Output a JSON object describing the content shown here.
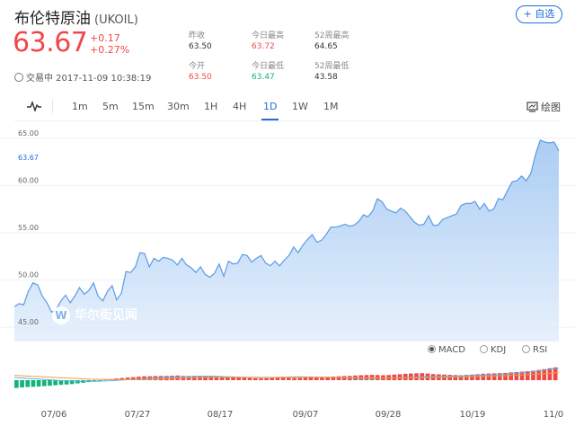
{
  "header": {
    "name": "布伦特原油",
    "code": "(UKOIL)",
    "add_label": "+ 自选",
    "price": "63.67",
    "change_abs": "+0.17",
    "change_pct": "+0.27%",
    "status": "交易中 2017-11-09 10:38:19"
  },
  "stats": {
    "prev_close": {
      "label": "昨收",
      "value": "63.50"
    },
    "day_high": {
      "label": "今日最高",
      "value": "63.72"
    },
    "week52_high": {
      "label": "52周最高",
      "value": "64.65"
    },
    "open": {
      "label": "今开",
      "value": "63.50"
    },
    "day_low": {
      "label": "今日最低",
      "value": "63.47"
    },
    "week52_low": {
      "label": "52周最低",
      "value": "43.58"
    }
  },
  "tabs": [
    "1m",
    "5m",
    "15m",
    "30m",
    "1H",
    "4H",
    "1D",
    "1W",
    "1M"
  ],
  "active_tab": "1D",
  "draw_label": "绘图",
  "indicators": [
    "MACD",
    "KDJ",
    "RSI"
  ],
  "active_indicator": "MACD",
  "watermark": "华尔街见闻",
  "colors": {
    "up": "#f04848",
    "down": "#13b37a",
    "accent": "#1e6fd9",
    "line": "#5b9be6"
  },
  "chart_data": {
    "type": "area",
    "last_label": "63.67",
    "ylim": [
      43.5,
      66.5
    ],
    "yticks": [
      "65.00",
      "60.00",
      "55.00",
      "50.00",
      "45.00"
    ],
    "xticks": [
      "07/06",
      "07/27",
      "08/17",
      "09/07",
      "09/28",
      "10/19",
      "11/0"
    ],
    "values": [
      47.2,
      47.5,
      47.4,
      48.8,
      49.7,
      49.5,
      48.3,
      47.6,
      46.6,
      46.9,
      47.8,
      48.4,
      47.6,
      48.3,
      49.2,
      48.5,
      48.9,
      49.7,
      48.3,
      47.8,
      48.8,
      49.4,
      47.9,
      48.6,
      50.9,
      50.8,
      51.4,
      52.9,
      52.8,
      51.4,
      52.3,
      52.0,
      52.4,
      52.3,
      52.1,
      51.6,
      52.3,
      51.6,
      51.3,
      50.8,
      51.4,
      50.6,
      50.3,
      50.7,
      51.7,
      50.4,
      52.0,
      51.7,
      51.8,
      52.7,
      52.6,
      51.9,
      52.3,
      52.6,
      51.8,
      51.5,
      52.0,
      51.5,
      52.1,
      52.6,
      53.5,
      52.9,
      53.7,
      54.3,
      54.8,
      54.0,
      54.2,
      54.8,
      55.6,
      55.6,
      55.7,
      55.9,
      55.7,
      55.8,
      56.2,
      56.9,
      56.7,
      57.3,
      58.6,
      58.3,
      57.5,
      57.3,
      57.1,
      57.6,
      57.3,
      56.7,
      56.1,
      55.8,
      55.9,
      56.8,
      55.8,
      55.8,
      56.4,
      56.6,
      56.8,
      57.0,
      57.9,
      58.1,
      58.1,
      58.3,
      57.5,
      58.1,
      57.3,
      57.5,
      58.6,
      58.5,
      59.5,
      60.4,
      60.5,
      61.0,
      60.5,
      61.3,
      63.3,
      64.8,
      64.6,
      64.5,
      64.6,
      63.67
    ],
    "macd": {
      "hist": [
        -0.9,
        -0.85,
        -0.8,
        -0.78,
        -0.75,
        -0.7,
        -0.65,
        -0.6,
        -0.55,
        -0.5,
        -0.45,
        -0.38,
        -0.3,
        -0.22,
        -0.15,
        -0.08,
        0.05,
        0.12,
        0.2,
        0.25,
        0.3,
        0.35,
        0.4,
        0.45,
        0.45,
        0.48,
        0.5,
        0.5,
        0.52,
        0.55,
        0.5,
        0.48,
        0.5,
        0.52,
        0.5,
        0.45,
        0.42,
        0.4,
        0.38,
        0.35,
        0.3,
        0.28,
        0.25,
        0.22,
        0.2,
        0.22,
        0.25,
        0.28,
        0.3,
        0.28,
        0.26,
        0.28,
        0.3,
        0.32,
        0.35,
        0.38,
        0.4,
        0.42,
        0.45,
        0.48,
        0.5,
        0.55,
        0.58,
        0.6,
        0.62,
        0.6,
        0.58,
        0.6,
        0.65,
        0.7,
        0.75,
        0.78,
        0.8,
        0.82,
        0.78,
        0.72,
        0.68,
        0.65,
        0.62,
        0.6,
        0.58,
        0.62,
        0.65,
        0.7,
        0.75,
        0.78,
        0.8,
        0.82,
        0.85,
        0.9,
        0.95,
        1.0,
        1.05,
        1.1,
        1.2,
        1.3,
        1.4,
        1.5
      ],
      "dif": [
        0.5,
        0.4,
        0.3,
        0.2,
        0.1,
        0.0,
        -0.1,
        -0.15,
        -0.2,
        -0.22,
        -0.2,
        -0.15,
        -0.1,
        0.0,
        0.1,
        0.2,
        0.3,
        0.4,
        0.5,
        0.55,
        0.6,
        0.65,
        0.7,
        0.72,
        0.75,
        0.7,
        0.65,
        0.6,
        0.55,
        0.5,
        0.48,
        0.45,
        0.5,
        0.55,
        0.6,
        0.62,
        0.6,
        0.58,
        0.55,
        0.5,
        0.45,
        0.4,
        0.35,
        0.3,
        0.32,
        0.35,
        0.4,
        0.45,
        0.5,
        0.55,
        0.6,
        0.65,
        0.7,
        0.72,
        0.75,
        0.8,
        0.85,
        0.9,
        0.95,
        1.0,
        1.1,
        1.2,
        1.3,
        1.45,
        1.6,
        1.8,
        2.0,
        2.2
      ],
      "dea": [
        0.9,
        0.82,
        0.74,
        0.66,
        0.58,
        0.5,
        0.42,
        0.35,
        0.28,
        0.22,
        0.17,
        0.13,
        0.1,
        0.1,
        0.12,
        0.15,
        0.18,
        0.22,
        0.26,
        0.3,
        0.34,
        0.38,
        0.42,
        0.46,
        0.5,
        0.52,
        0.54,
        0.55,
        0.55,
        0.54,
        0.53,
        0.52,
        0.52,
        0.53,
        0.54,
        0.55,
        0.55,
        0.55,
        0.54,
        0.52,
        0.5,
        0.48,
        0.45,
        0.43,
        0.41,
        0.4,
        0.4,
        0.41,
        0.43,
        0.45,
        0.47,
        0.5,
        0.52,
        0.55,
        0.58,
        0.61,
        0.65,
        0.69,
        0.73,
        0.77,
        0.82,
        0.88,
        0.94,
        1.0,
        1.08,
        1.18,
        1.3,
        1.42
      ]
    }
  }
}
